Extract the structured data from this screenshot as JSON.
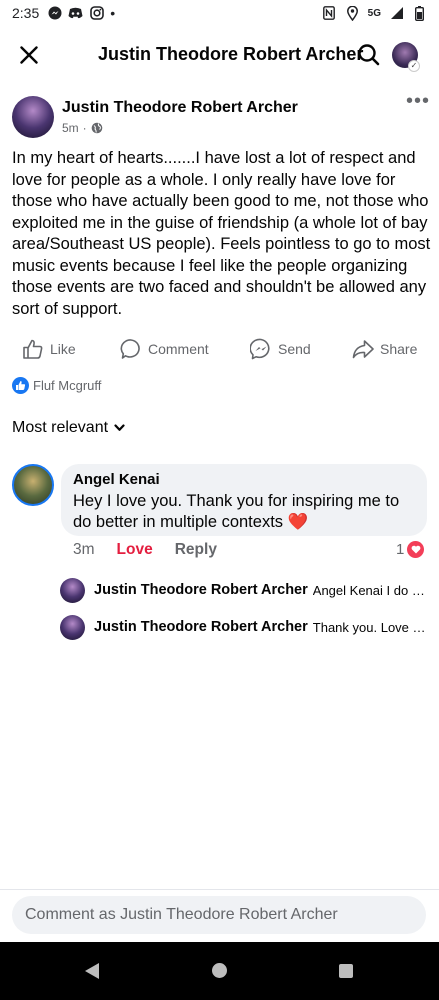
{
  "status_bar": {
    "time": "2:35",
    "dot": "•",
    "network": "5G",
    "left_icons": [
      "messenger-icon",
      "discord-icon",
      "instagram-icon"
    ],
    "right_icons": [
      "nfc-icon",
      "location-icon",
      "signal-icon",
      "battery-icon"
    ]
  },
  "top_bar": {
    "title": "Justin Theodore Robert Archer",
    "avatar_badge": "✓"
  },
  "post": {
    "author": "Justin Theodore Robert Archer",
    "time": "5m",
    "separator": "·",
    "more": "•••",
    "body": "In my heart of hearts.......I have lost a lot of respect and love for people as a whole. I only really have love for those who have actually been good to me, not those who exploited me in the guise of friendship (a whole lot of bay area/Southeast US people). Feels pointless to go to most music events because I feel like the people organizing those events are two faced and shouldn't be allowed any sort of support."
  },
  "actions": {
    "like": "Like",
    "comment": "Comment",
    "send": "Send",
    "share": "Share"
  },
  "reactions": {
    "names": "Fluf Mcgruff"
  },
  "sort": {
    "label": "Most relevant"
  },
  "comment": {
    "author": "Angel Kenai",
    "text": "Hey I love you. Thank you for inspiring me to do better in multiple contexts",
    "emoji": "❤️",
    "time": "3m",
    "love": "Love",
    "reply": "Reply",
    "reaction_count": "1"
  },
  "replies": [
    {
      "author": "Justin Theodore Robert Archer",
      "text": "Angel Kenai I do w..."
    },
    {
      "author": "Justin Theodore Robert Archer",
      "text": "Thank you. Love yo..."
    }
  ],
  "composer": {
    "placeholder": "Comment as Justin Theodore Robert Archer"
  },
  "colors": {
    "accent": "#1877f2",
    "love": "#e41e3f",
    "muted": "#65676b",
    "bubble": "#f0f2f5"
  }
}
